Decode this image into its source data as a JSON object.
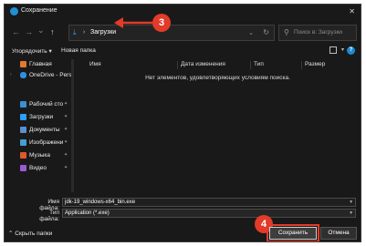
{
  "window": {
    "title": "Сохранение",
    "close_glyph": "✕"
  },
  "nav": {
    "back": "←",
    "forward": "→",
    "recent": "⌄",
    "up": "↑",
    "address_crumb_sep": "›",
    "address_crumb": "Загрузки",
    "address_chevron": "⌄",
    "refresh": "↻",
    "search_placeholder": "Поиск в: Загрузки"
  },
  "annotations": {
    "step_3": "3",
    "step_4": "4",
    "accent_color": "#e23b2a"
  },
  "toolbar": {
    "organize": "Упорядочить ▾",
    "new_folder": "Новая папка",
    "help": "?"
  },
  "sidebar": {
    "items": [
      {
        "label": "Главная",
        "icon": "home-icon",
        "pin": ""
      },
      {
        "label": "OneDrive - Pers",
        "icon": "onedrive-icon",
        "pin": ""
      },
      {
        "label": "Рабочий сто",
        "icon": "desktop-icon",
        "pin": "📌"
      },
      {
        "label": "Загрузки",
        "icon": "download-icon",
        "pin": "📌"
      },
      {
        "label": "Документы",
        "icon": "documents-icon",
        "pin": "📌"
      },
      {
        "label": "Изображени",
        "icon": "pictures-icon",
        "pin": "📌"
      },
      {
        "label": "Музыка",
        "icon": "music-icon",
        "pin": "📌"
      },
      {
        "label": "Видео",
        "icon": "video-icon",
        "pin": "📌"
      }
    ]
  },
  "content": {
    "columns": [
      "Имя",
      "Дата изменения",
      "Тип",
      "Размер"
    ],
    "empty_message": "Нет элементов, удовлетворяющих условиям поиска."
  },
  "fields": {
    "filename_label": "Имя файла:",
    "filename_value": "jdk-19_windows-x64_bin.exe",
    "type_label": "Тип файла:",
    "type_value": "Application (*.exe)"
  },
  "footer": {
    "hide_folders": "⌃ Скрыть папки",
    "save": "Сохранить",
    "cancel": "Отмена"
  }
}
